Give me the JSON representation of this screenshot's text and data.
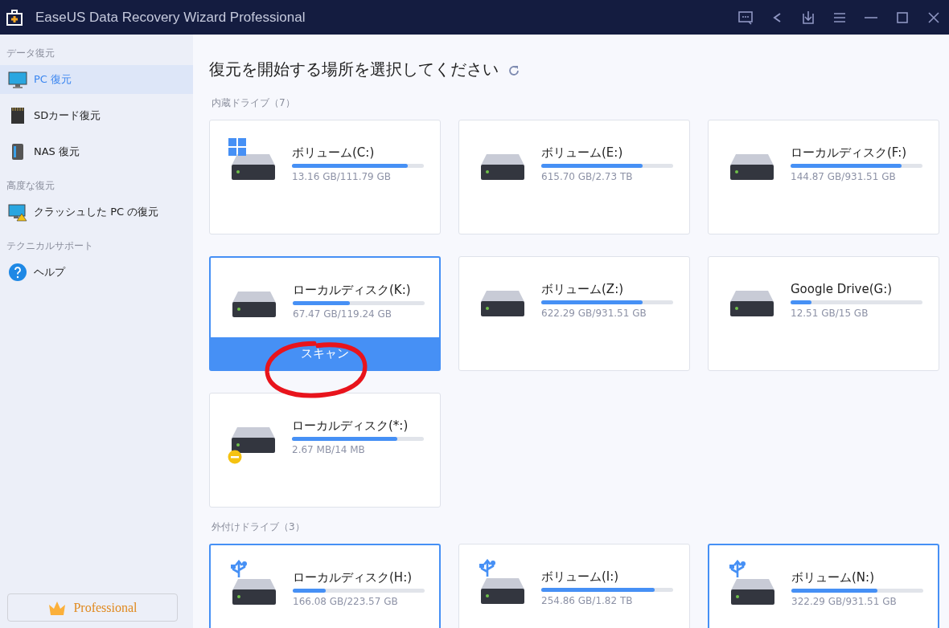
{
  "window": {
    "title": "EaseUS Data Recovery Wizard Professional"
  },
  "sidebar": {
    "sections": [
      {
        "heading": "データ復元",
        "items": [
          {
            "label": "PC 復元",
            "selected": true
          },
          {
            "label": "SDカード復元",
            "selected": false
          },
          {
            "label": "NAS 復元",
            "selected": false
          }
        ]
      },
      {
        "heading": "高度な復元",
        "items": [
          {
            "label": "クラッシュした PC の復元",
            "selected": false
          }
        ]
      },
      {
        "heading": "テクニカルサポート",
        "items": [
          {
            "label": "ヘルプ",
            "selected": false
          }
        ]
      }
    ],
    "edition_button": "Professional"
  },
  "main": {
    "title": "復元を開始する場所を選択してください",
    "groups": [
      {
        "heading": "内蔵ドライブ（7）",
        "drives": [
          {
            "name": "ボリューム(C:)",
            "usage": "13.16 GB/111.79 GB",
            "level": 0.88,
            "kind": "system",
            "selected": false
          },
          {
            "name": "ボリューム(E:)",
            "usage": "615.70 GB/2.73 TB",
            "level": 0.77,
            "selected": false
          },
          {
            "name": "ローカルディスク(F:)",
            "usage": "144.87 GB/931.51 GB",
            "level": 0.84,
            "selected": false
          },
          {
            "name": "ローカルディスク(K:)",
            "usage": "67.47 GB/119.24 GB",
            "level": 0.43,
            "selected": true,
            "scan_button": "スキャン"
          },
          {
            "name": "ボリューム(Z:)",
            "usage": "622.29 GB/931.51 GB",
            "level": 0.77,
            "selected": false
          },
          {
            "name": "Google Drive(G:)",
            "usage": "12.51 GB/15 GB",
            "level": 0.16,
            "selected": false
          },
          {
            "name": "ローカルディスク(*:)",
            "usage": "2.67 MB/14 MB",
            "level": 0.8,
            "kind": "unavailable",
            "selected": false
          }
        ]
      },
      {
        "heading": "外付けドライブ（3）",
        "drives": [
          {
            "name": "ローカルディスク(H:)",
            "usage": "166.08 GB/223.57 GB",
            "level": 0.25,
            "kind": "usb",
            "selected": true
          },
          {
            "name": "ボリューム(I:)",
            "usage": "254.86 GB/1.82 TB",
            "level": 0.86,
            "kind": "usb",
            "selected": false
          },
          {
            "name": "ボリューム(N:)",
            "usage": "322.29 GB/931.51 GB",
            "level": 0.65,
            "kind": "usb",
            "selected": true
          }
        ]
      }
    ]
  }
}
